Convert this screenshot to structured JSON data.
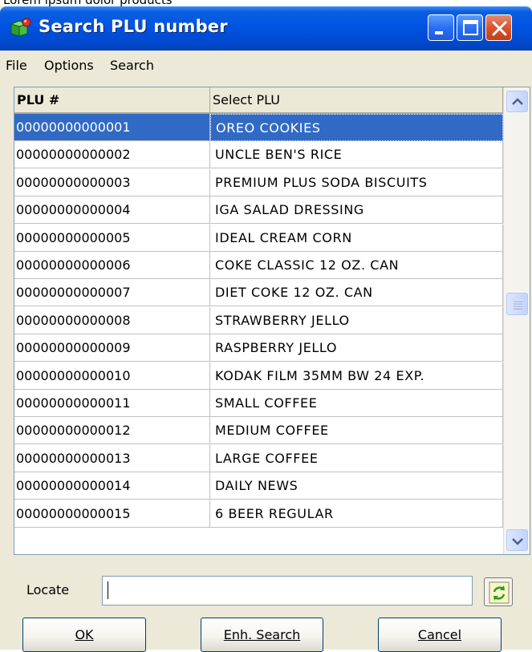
{
  "window": {
    "title": "Search PLU number",
    "controls": [
      "minimize-icon",
      "maximize-icon",
      "close-icon"
    ]
  },
  "menu": {
    "items": [
      {
        "label": "File"
      },
      {
        "label": "Options"
      },
      {
        "label": "Search"
      }
    ]
  },
  "grid": {
    "columns": [
      "PLU #",
      "Select PLU"
    ],
    "selected_row": 0,
    "rows": [
      {
        "plu": "00000000000001",
        "name": "OREO COOKIES"
      },
      {
        "plu": "00000000000002",
        "name": "UNCLE BEN'S RICE"
      },
      {
        "plu": "00000000000003",
        "name": "PREMIUM PLUS SODA BISCUITS"
      },
      {
        "plu": "00000000000004",
        "name": "IGA SALAD DRESSING"
      },
      {
        "plu": "00000000000005",
        "name": "IDEAL CREAM CORN"
      },
      {
        "plu": "00000000000006",
        "name": "COKE CLASSIC 12 OZ. CAN"
      },
      {
        "plu": "00000000000007",
        "name": "DIET COKE 12 OZ. CAN"
      },
      {
        "plu": "00000000000008",
        "name": "STRAWBERRY JELLO"
      },
      {
        "plu": "00000000000009",
        "name": "RASPBERRY JELLO"
      },
      {
        "plu": "00000000000010",
        "name": "KODAK FILM 35MM BW 24 EXP."
      },
      {
        "plu": "00000000000011",
        "name": "SMALL COFFEE"
      },
      {
        "plu": "00000000000012",
        "name": "MEDIUM COFFEE"
      },
      {
        "plu": "00000000000013",
        "name": "LARGE COFFEE"
      },
      {
        "plu": "00000000000014",
        "name": "DAILY NEWS"
      },
      {
        "plu": "00000000000015",
        "name": "6 BEER REGULAR"
      }
    ]
  },
  "locate": {
    "label": "Locate",
    "value": ""
  },
  "buttons": {
    "ok": "OK",
    "enh_search": "Enh. Search",
    "cancel": "Cancel"
  },
  "colors": {
    "titlebar": "#0054e3",
    "selection": "#316ac5",
    "window_bg": "#ece9d8"
  }
}
